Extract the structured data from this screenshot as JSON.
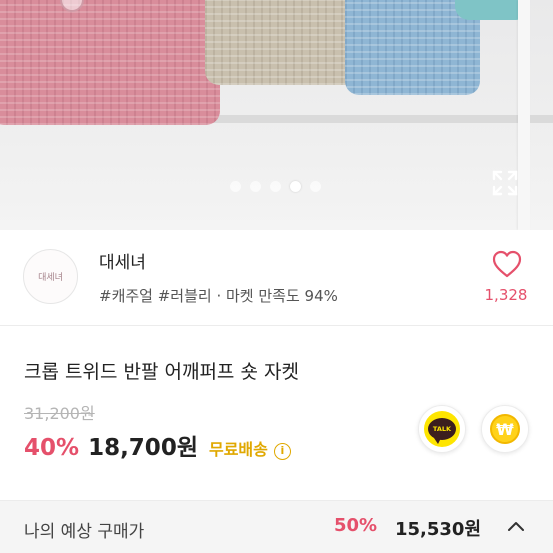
{
  "carousel": {
    "total_images": 5,
    "active_index": 3
  },
  "shop": {
    "avatar_text": "대세녀",
    "name": "대세녀",
    "tags": "#캐주얼 #러블리 · 마켓 만족도 94%",
    "like_count": "1,328"
  },
  "product": {
    "title": "크롭 트위드 반팔 어깨퍼프 숏 자켓",
    "original_price": "31,200원",
    "discount": "40%",
    "price": "18,700원",
    "shipping": "무료배송"
  },
  "actions": {
    "talk_label": "TALK",
    "pay_label": "₩"
  },
  "expected_price": {
    "label": "나의 예상 구매가",
    "discount": "50%",
    "price": "15,530원"
  },
  "colors": {
    "accent_pink": "#e5506b",
    "shipping_yellow": "#e0a800",
    "kakao_yellow": "#fee500"
  }
}
